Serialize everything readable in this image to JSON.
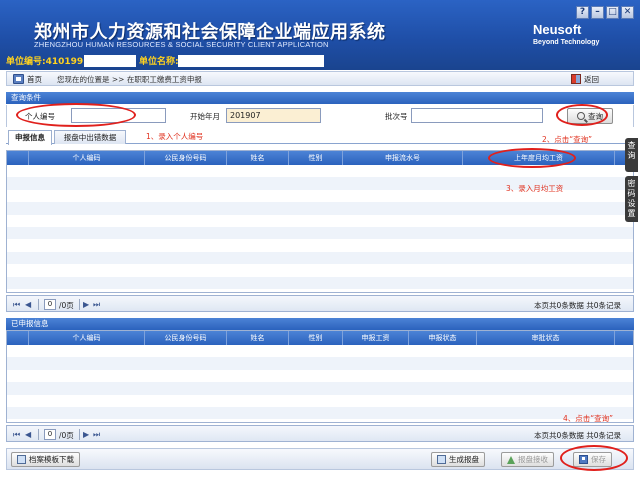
{
  "header": {
    "title_cn": "郑州市人力资源和社会保障企业端应用系统",
    "title_en": "ZHENGZHOU HUMAN RESOURCES & SOCIAL SECURITY CLIENT APPLICATION",
    "brand": "Neusoft",
    "brand_sub": "Beyond Technology",
    "unit_code_label": "单位编号:410199",
    "unit_name_label": "单位名称:",
    "window_buttons": [
      "?",
      "–",
      "□",
      "✕"
    ]
  },
  "breadcrumb": {
    "home": "首页",
    "path": "您现在的位置是 >> 在职职工缴费工资申报",
    "back": "返回"
  },
  "query": {
    "section_title": "查询条件",
    "personal_id_label": "个人编号",
    "personal_id_value": "",
    "start_month_label": "开始年月",
    "start_month_value": "201907",
    "batch_label": "批次号",
    "batch_value": "",
    "query_button": "查询"
  },
  "tabs": [
    {
      "label": "申报信息",
      "active": true
    },
    {
      "label": "报盘中出错数据",
      "active": false
    }
  ],
  "declare_grid": {
    "columns": [
      "个人编码",
      "公民身份号码",
      "姓名",
      "性别",
      "申报流水号",
      "上年度月均工资"
    ],
    "rows": []
  },
  "pager": {
    "first": "⏮",
    "prev": "◀",
    "page_value": "0",
    "page_total": "/0页",
    "next": "▶",
    "last": "⏭",
    "summary": "本页共0条数据 共0条记录"
  },
  "declared_section": {
    "title": "已申报信息",
    "columns": [
      "个人编码",
      "公民身份号码",
      "姓名",
      "性别",
      "申报工资",
      "申报状态",
      "审批状态"
    ],
    "rows": []
  },
  "annotations": {
    "step1": "1、录入个人编号",
    "step2": "2、点击“查询”",
    "step3": "3、录入月均工资",
    "step4": "4、点击“查询”"
  },
  "toolbar": {
    "template_download": "档案模板下载",
    "generate": "生成报盘",
    "receive": "报盘接收",
    "save": "保存"
  },
  "side_tabs": [
    "查询",
    "密码设置"
  ],
  "colors": {
    "header_blue": "#1f4fa8",
    "grid_header": "#2b62bd",
    "unit_label": "#ffd21f",
    "annotation_red": "#e0201c"
  }
}
